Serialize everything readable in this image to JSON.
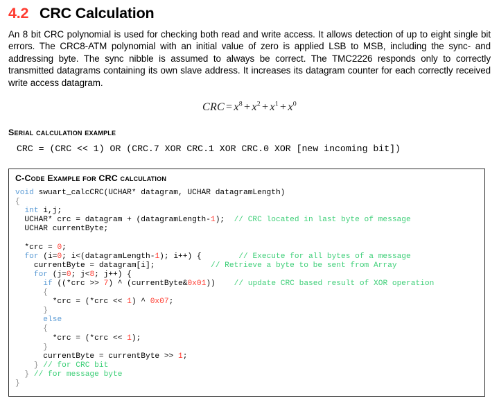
{
  "section": {
    "number": "4.2",
    "title": "CRC Calculation"
  },
  "paragraph": "An 8 bit CRC polynomial is used for checking both read and write access. It allows detection of up to eight single bit errors. The CRC8-ATM polynomial with an initial value of zero is applied LSB to MSB, including the sync- and addressing byte. The sync nibble is assumed to always be correct. The TMC2226 responds only to correctly transmitted datagrams containing its own slave address. It increases its datagram counter for each correctly received write access datagram.",
  "formula": {
    "lhs": "CRC",
    "equals": "=",
    "terms": [
      {
        "base": "x",
        "exp": "8"
      },
      {
        "base": "x",
        "exp": "2"
      },
      {
        "base": "x",
        "exp": "1"
      },
      {
        "base": "x",
        "exp": "0"
      }
    ],
    "plain_text": "CRC = x8 + x2 + x1 + x0"
  },
  "serial_example": {
    "heading": "Serial calculation example",
    "code": "CRC = (CRC << 1) OR (CRC.7 XOR CRC.1 XOR CRC.0 XOR [new incoming bit])"
  },
  "code_box": {
    "title": "C-Code Example for CRC calculation",
    "colors": {
      "keyword": "#5b9bd5",
      "number": "#ff3b30",
      "comment": "#3ecf78",
      "brace": "#8f8f8f",
      "text": "#000000",
      "border": "#2b2b2b"
    },
    "lines": [
      [
        {
          "t": "void ",
          "c": "kw"
        },
        {
          "t": "swuart_calcCRC(UCHAR* datagram, UCHAR datagramLength)",
          "c": "plain"
        }
      ],
      [
        {
          "t": "{",
          "c": "brc"
        }
      ],
      [
        {
          "t": "  ",
          "c": "plain"
        },
        {
          "t": "int",
          "c": "kw"
        },
        {
          "t": " i,j;",
          "c": "plain"
        }
      ],
      [
        {
          "t": "  UCHAR* crc = datagram + (datagramLength-",
          "c": "plain"
        },
        {
          "t": "1",
          "c": "num"
        },
        {
          "t": ");  ",
          "c": "plain"
        },
        {
          "t": "// CRC located in last byte of message",
          "c": "cmt"
        }
      ],
      [
        {
          "t": "  UCHAR currentByte;",
          "c": "plain"
        }
      ],
      [
        {
          "t": "",
          "c": "plain"
        }
      ],
      [
        {
          "t": "  *crc = ",
          "c": "plain"
        },
        {
          "t": "0",
          "c": "num"
        },
        {
          "t": ";",
          "c": "plain"
        }
      ],
      [
        {
          "t": "  ",
          "c": "plain"
        },
        {
          "t": "for",
          "c": "kw"
        },
        {
          "t": " (i=",
          "c": "plain"
        },
        {
          "t": "0",
          "c": "num"
        },
        {
          "t": "; i<(datagramLength-",
          "c": "plain"
        },
        {
          "t": "1",
          "c": "num"
        },
        {
          "t": "); i++) {        ",
          "c": "plain"
        },
        {
          "t": "// Execute for all bytes of a message",
          "c": "cmt"
        }
      ],
      [
        {
          "t": "    currentByte = datagram[i];            ",
          "c": "plain"
        },
        {
          "t": "// Retrieve a byte to be sent from Array",
          "c": "cmt"
        }
      ],
      [
        {
          "t": "    ",
          "c": "plain"
        },
        {
          "t": "for",
          "c": "kw"
        },
        {
          "t": " (j=",
          "c": "plain"
        },
        {
          "t": "0",
          "c": "num"
        },
        {
          "t": "; j<",
          "c": "plain"
        },
        {
          "t": "8",
          "c": "num"
        },
        {
          "t": "; j++) {",
          "c": "plain"
        }
      ],
      [
        {
          "t": "      ",
          "c": "plain"
        },
        {
          "t": "if",
          "c": "kw"
        },
        {
          "t": " ((*crc >> ",
          "c": "plain"
        },
        {
          "t": "7",
          "c": "num"
        },
        {
          "t": ") ^ (currentByte&",
          "c": "plain"
        },
        {
          "t": "0x01",
          "c": "num"
        },
        {
          "t": "))    ",
          "c": "plain"
        },
        {
          "t": "// update CRC based result of XOR operation",
          "c": "cmt"
        }
      ],
      [
        {
          "t": "      {",
          "c": "brc"
        }
      ],
      [
        {
          "t": "        *crc = (*crc << ",
          "c": "plain"
        },
        {
          "t": "1",
          "c": "num"
        },
        {
          "t": ") ^ ",
          "c": "plain"
        },
        {
          "t": "0x07",
          "c": "num"
        },
        {
          "t": ";",
          "c": "plain"
        }
      ],
      [
        {
          "t": "      }",
          "c": "brc"
        }
      ],
      [
        {
          "t": "      ",
          "c": "plain"
        },
        {
          "t": "else",
          "c": "kw"
        }
      ],
      [
        {
          "t": "      {",
          "c": "brc"
        }
      ],
      [
        {
          "t": "        *crc = (*crc << ",
          "c": "plain"
        },
        {
          "t": "1",
          "c": "num"
        },
        {
          "t": ");",
          "c": "plain"
        }
      ],
      [
        {
          "t": "      }",
          "c": "brc"
        }
      ],
      [
        {
          "t": "      currentByte = currentByte >> ",
          "c": "plain"
        },
        {
          "t": "1",
          "c": "num"
        },
        {
          "t": ";",
          "c": "plain"
        }
      ],
      [
        {
          "t": "    }",
          "c": "brc"
        },
        {
          "t": " // for CRC bit",
          "c": "cmt"
        }
      ],
      [
        {
          "t": "  }",
          "c": "brc"
        },
        {
          "t": " // for message byte",
          "c": "cmt"
        }
      ],
      [
        {
          "t": "}",
          "c": "brc"
        }
      ]
    ]
  }
}
